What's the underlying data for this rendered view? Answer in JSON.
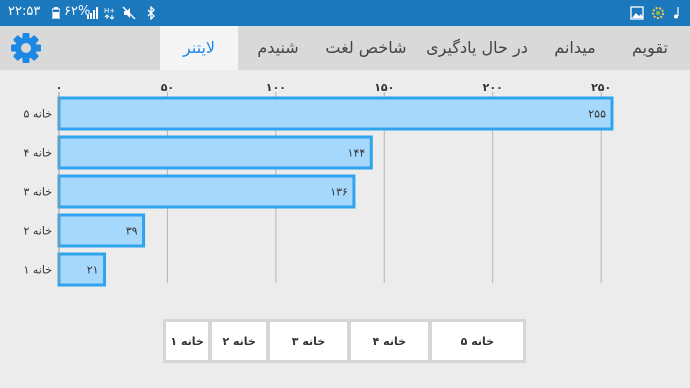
{
  "status_bar": {
    "time": "۲۲:۵۳",
    "battery_percent": "۶۲%"
  },
  "tabs": [
    {
      "label": "تقویم",
      "active": false
    },
    {
      "label": "میدانم",
      "active": false
    },
    {
      "label": "در حال یادگیری",
      "active": false
    },
    {
      "label": "شاخص لغت",
      "active": false
    },
    {
      "label": "شنیدم",
      "active": false
    },
    {
      "label": "لایتنر",
      "active": true
    }
  ],
  "icons": {
    "settings": "gear-icon"
  },
  "colors": {
    "status_bar": "#1c78bd",
    "accent": "#1e88e5",
    "bar_fill": "#a6d8fb",
    "bar_stroke": "#2ea4ee"
  },
  "chart_data": {
    "type": "bar",
    "orientation": "horizontal",
    "categories": [
      "خانه ۵",
      "خانه ۴",
      "خانه ۳",
      "خانه ۲",
      "خانه ۱"
    ],
    "values": [
      255,
      144,
      136,
      39,
      21
    ],
    "value_labels": [
      "۲۵۵",
      "۱۴۴",
      "۱۳۶",
      "۳۹",
      "۲۱"
    ],
    "xlim": [
      0,
      255
    ],
    "x_ticks": [
      0,
      50,
      100,
      150,
      200,
      250
    ],
    "x_tick_labels": [
      "۰",
      "۵۰",
      "۱۰۰",
      "۱۵۰",
      "۲۰۰",
      "۲۵۰"
    ],
    "x_axis_position": "top",
    "grid": true,
    "legend": [
      "خانه ۵",
      "خانه ۴",
      "خانه ۳",
      "خانه ۲",
      "خانه ۱"
    ],
    "legend_placement": "bottom-center"
  }
}
